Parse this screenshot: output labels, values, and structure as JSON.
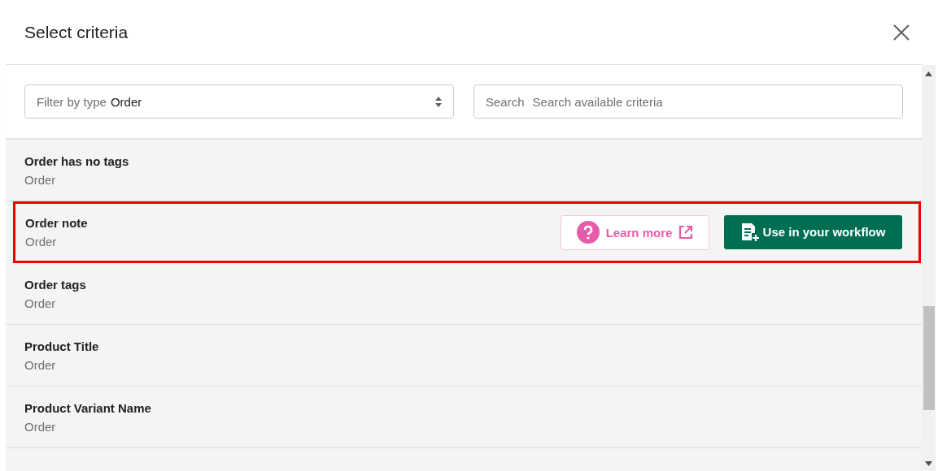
{
  "dialog": {
    "title": "Select criteria"
  },
  "filter": {
    "label": "Filter by type",
    "value": "Order"
  },
  "search": {
    "label": "Search",
    "placeholder": "Search available criteria"
  },
  "criteria": [
    {
      "name": "Order has no tags",
      "type": "Order",
      "highlighted": false
    },
    {
      "name": "Order note",
      "type": "Order",
      "highlighted": true,
      "actions": {
        "learn_more": "Learn more",
        "use": "Use in your workflow"
      }
    },
    {
      "name": "Order tags",
      "type": "Order",
      "highlighted": false
    },
    {
      "name": "Product Title",
      "type": "Order",
      "highlighted": false
    },
    {
      "name": "Product Variant Name",
      "type": "Order",
      "highlighted": false
    }
  ]
}
